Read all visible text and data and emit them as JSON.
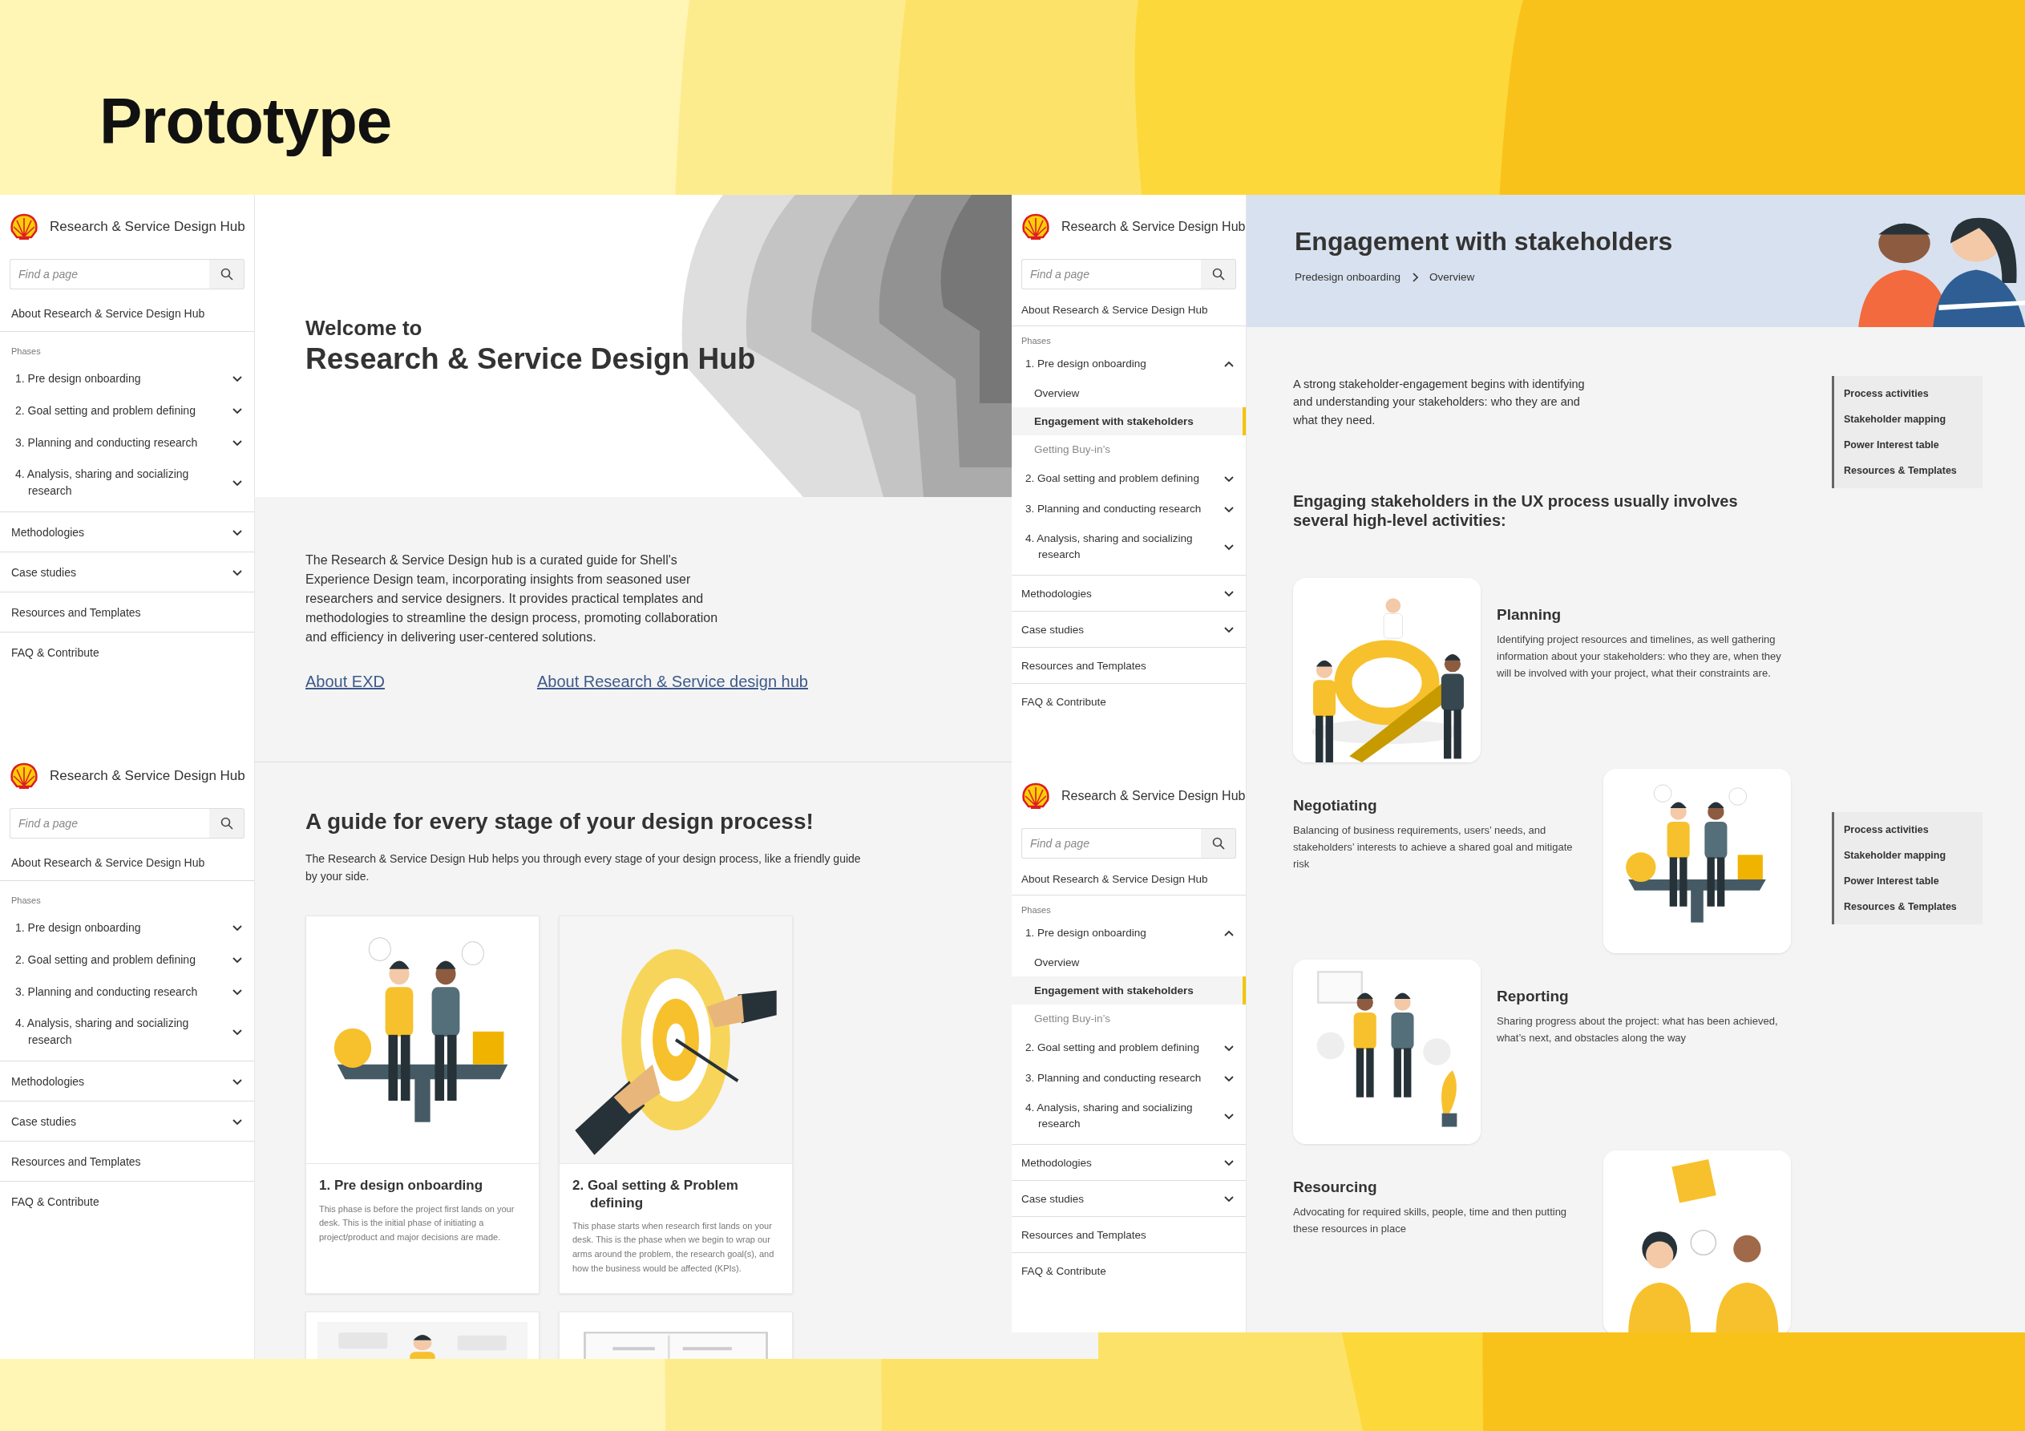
{
  "slide_title": "Prototype",
  "sidebars_left": [
    {
      "title": "Research & Service Design Hub",
      "search": {
        "placeholder": "Find a page"
      },
      "about": "About Research & Service Design Hub",
      "phases_label": "Phases",
      "phases": [
        {
          "label": "1. Pre design onboarding",
          "expanded": false
        },
        {
          "label": "2. Goal setting and problem defining",
          "expanded": false
        },
        {
          "label": "3. Planning and conducting research",
          "expanded": false
        },
        {
          "label": "4. Analysis, sharing and socializing research",
          "expanded": false
        }
      ],
      "sections": [
        {
          "label": "Methodologies",
          "expandable": true
        },
        {
          "label": "Case studies",
          "expandable": true
        },
        {
          "label": "Resources and Templates",
          "expandable": false
        },
        {
          "label": "FAQ & Contribute",
          "expandable": false
        }
      ]
    },
    {
      "title": "Research & Service Design Hub",
      "search": {
        "placeholder": "Find a page"
      },
      "about": "About Research & Service Design Hub",
      "phases_label": "Phases",
      "phases": [
        {
          "label": "1. Pre design onboarding",
          "expanded": false
        },
        {
          "label": "2. Goal setting and problem defining",
          "expanded": false
        },
        {
          "label": "3. Planning and conducting research",
          "expanded": false
        },
        {
          "label": "4. Analysis, sharing and socializing research",
          "expanded": false
        }
      ],
      "sections": [
        {
          "label": "Methodologies",
          "expandable": true
        },
        {
          "label": "Case studies",
          "expandable": true
        },
        {
          "label": "Resources and Templates",
          "expandable": false
        },
        {
          "label": "FAQ & Contribute",
          "expandable": false
        }
      ]
    }
  ],
  "home_page": {
    "welcome": "Welcome to",
    "heading": "Research & Service Design Hub",
    "intro": "The Research & Service Design hub  is a curated guide for Shell's Experience Design team, incorporating insights from seasoned user researchers and service designers. It provides practical templates and methodologies to streamline the design process, promoting collaboration and efficiency in delivering user-centered solutions.",
    "links": [
      "About EXD",
      "About Research & Service design hub"
    ],
    "guide_heading": "A guide for every stage of your design process!",
    "guide_text": "The Research & Service Design Hub helps you through every stage of your design process, like a friendly guide by your side.",
    "cards": [
      {
        "title": "1. Pre design onboarding",
        "text": "This phase is before the project first lands on your desk. This is the initial phase of initiating a project/product and major decisions are made."
      },
      {
        "title": "2. Goal setting & Problem defining",
        "text": "This phase starts when research first lands on your desk. This is the phase when we begin to wrap our arms around the problem, the research goal(s), and how the business would be affected (KPIs)."
      }
    ],
    "partial_cards": [
      {
        "kind": "picture"
      },
      {
        "kind": "picture"
      }
    ]
  },
  "sidebars_middle": [
    {
      "title": "Research & Service Design Hub",
      "search": {
        "placeholder": "Find a page"
      },
      "about": "About Research & Service Design Hub",
      "phases_label": "Phases",
      "phases": [
        {
          "label": "1. Pre design onboarding",
          "expanded": true,
          "children": [
            {
              "label": "Overview",
              "selected": false,
              "dimmed": false
            },
            {
              "label": "Engagement with stakeholders",
              "selected": true,
              "dimmed": false
            },
            {
              "label": "Getting Buy-in’s",
              "selected": false,
              "dimmed": true
            }
          ]
        },
        {
          "label": "2. Goal setting and problem defining",
          "expanded": false
        },
        {
          "label": "3. Planning and conducting research",
          "expanded": false
        },
        {
          "label": "4. Analysis, sharing and socializing research",
          "expanded": false
        }
      ],
      "sections": [
        {
          "label": "Methodologies",
          "expandable": true
        },
        {
          "label": "Case studies",
          "expandable": true
        },
        {
          "label": "Resources and Templates",
          "expandable": false
        },
        {
          "label": "FAQ & Contribute",
          "expandable": false
        }
      ]
    },
    {
      "title": "Research & Service Design Hub",
      "search": {
        "placeholder": "Find a page"
      },
      "about": "About Research & Service Design Hub",
      "phases_label": "Phases",
      "phases": [
        {
          "label": "1. Pre design onboarding",
          "expanded": true,
          "children": [
            {
              "label": "Overview",
              "selected": false,
              "dimmed": false
            },
            {
              "label": "Engagement with stakeholders",
              "selected": true,
              "dimmed": false
            },
            {
              "label": "Getting Buy-in’s",
              "selected": false,
              "dimmed": true
            }
          ]
        },
        {
          "label": "2. Goal setting and problem defining",
          "expanded": false
        },
        {
          "label": "3. Planning and conducting research",
          "expanded": false
        },
        {
          "label": "4. Analysis, sharing and socializing research",
          "expanded": false
        }
      ],
      "sections": [
        {
          "label": "Methodologies",
          "expandable": true
        },
        {
          "label": "Case studies",
          "expandable": true
        },
        {
          "label": "Resources and Templates",
          "expandable": false
        },
        {
          "label": "FAQ & Contribute",
          "expandable": false
        }
      ]
    }
  ],
  "stakeholder_page": {
    "title": "Engagement with stakeholders",
    "breadcrumb": [
      "Predesign onboarding",
      "Overview"
    ],
    "intro": "A strong stakeholder-engagement begins with identifying and understanding your stakeholders: who they are and what they need.",
    "tocs": [
      {
        "items": [
          "Process activities",
          "Stakeholder mapping",
          "Power Interest table",
          "Resources & Templates"
        ]
      },
      {
        "items": [
          "Process activities",
          "Stakeholder mapping",
          "Power Interest table",
          "Resources & Templates"
        ]
      }
    ],
    "activities_heading": "Engaging stakeholders in the UX process usually involves several high-level activities:",
    "activities": [
      {
        "kind": "left",
        "title": "Planning",
        "text": "Identifying project resources and timelines, as well gathering information about your stakeholders: who they are, when they will be involved with your project, what their constraints are."
      },
      {
        "kind": "right",
        "title": "Negotiating",
        "text": "Balancing of business requirements, users’ needs, and stakeholders’ interests to achieve a shared goal and mitigate risk"
      },
      {
        "kind": "left",
        "title": "Reporting",
        "text": "Sharing progress about the project: what has been achieved, what’s next, and obstacles along the way"
      },
      {
        "kind": "right",
        "title": "Resourcing",
        "text": "Advocating for required skills, people, time and then putting these resources in place"
      }
    ]
  }
}
